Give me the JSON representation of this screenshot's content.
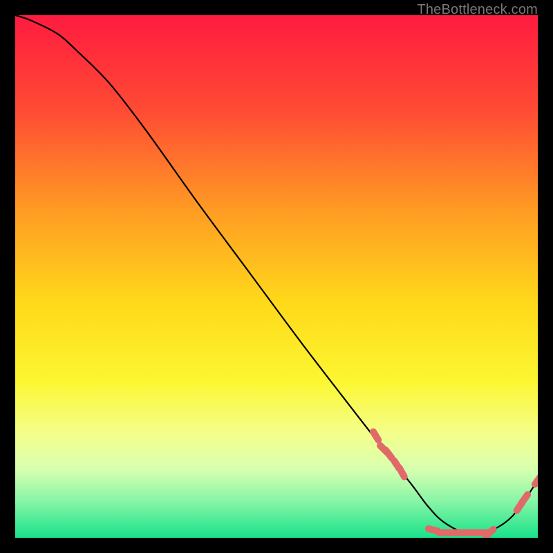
{
  "watermark": "TheBottleneck.com",
  "chart_data": {
    "type": "line",
    "title": "",
    "xlabel": "",
    "ylabel": "",
    "xlim": [
      0,
      100
    ],
    "ylim": [
      0,
      100
    ],
    "grid": false,
    "legend": false,
    "background_gradient": {
      "stops": [
        {
          "offset": 0.0,
          "color": "#ff1b3f"
        },
        {
          "offset": 0.18,
          "color": "#ff4a34"
        },
        {
          "offset": 0.38,
          "color": "#ff9e23"
        },
        {
          "offset": 0.55,
          "color": "#ffd91a"
        },
        {
          "offset": 0.7,
          "color": "#fcf631"
        },
        {
          "offset": 0.8,
          "color": "#f4ff8b"
        },
        {
          "offset": 0.87,
          "color": "#d7ffb0"
        },
        {
          "offset": 0.93,
          "color": "#87f5a6"
        },
        {
          "offset": 1.0,
          "color": "#19e28a"
        }
      ]
    },
    "series": [
      {
        "name": "curve",
        "color": "#000000",
        "x": [
          0,
          3,
          8,
          12,
          18,
          25,
          35,
          45,
          55,
          65,
          72,
          76,
          79,
          82,
          86,
          90,
          95,
          100
        ],
        "y": [
          100,
          99,
          96.5,
          93,
          87,
          78,
          64,
          50.5,
          37,
          24,
          15,
          10,
          6,
          3,
          1,
          1,
          4,
          11
        ]
      }
    ],
    "markers": {
      "style": "segments",
      "color": "#e06a6a",
      "points": [
        {
          "x": 69.0,
          "y": 19.5
        },
        {
          "x": 70.5,
          "y": 17.0
        },
        {
          "x": 71.5,
          "y": 16.0
        },
        {
          "x": 73.0,
          "y": 14.0
        },
        {
          "x": 74.0,
          "y": 12.5
        },
        {
          "x": 80.0,
          "y": 1.5
        },
        {
          "x": 82.0,
          "y": 1.0
        },
        {
          "x": 83.5,
          "y": 1.0
        },
        {
          "x": 85.0,
          "y": 1.0
        },
        {
          "x": 86.5,
          "y": 1.0
        },
        {
          "x": 88.0,
          "y": 1.0
        },
        {
          "x": 89.5,
          "y": 1.0
        },
        {
          "x": 90.8,
          "y": 1.0
        },
        {
          "x": 96.5,
          "y": 6.0
        },
        {
          "x": 97.5,
          "y": 7.5
        },
        {
          "x": 100.0,
          "y": 11.0
        }
      ]
    }
  }
}
